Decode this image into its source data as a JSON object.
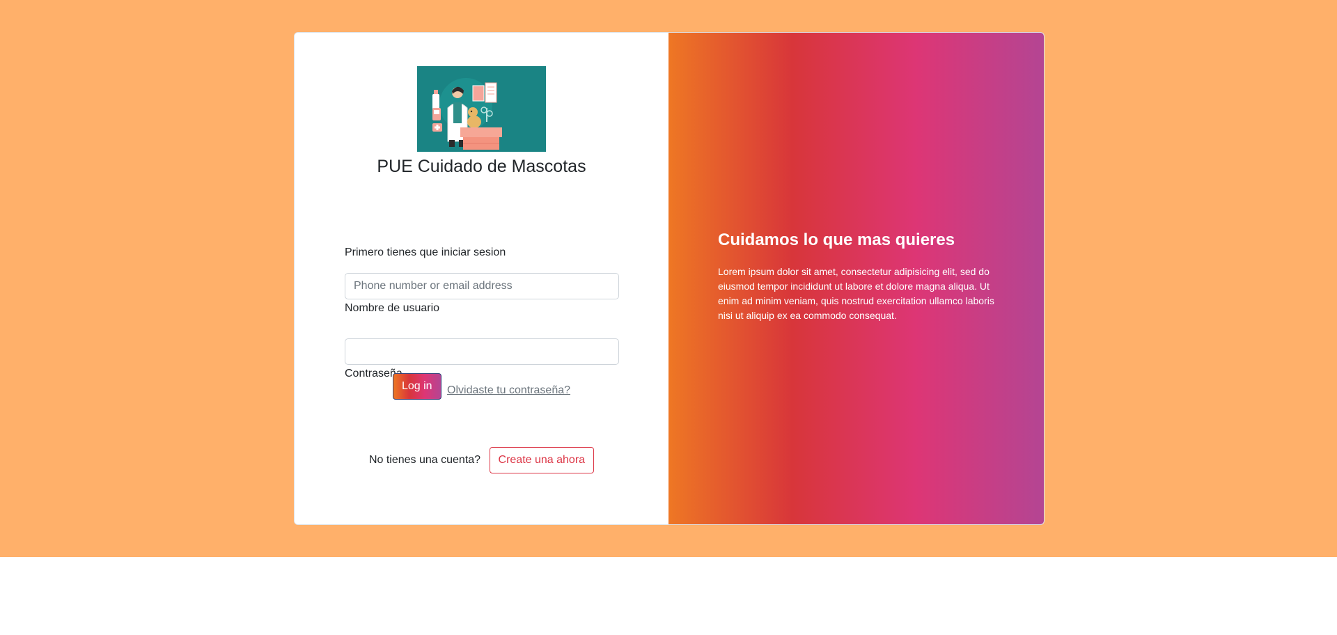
{
  "colors": {
    "page_background": "#ffb06a",
    "gradient": [
      "#ee7724",
      "#d8363a",
      "#dd3675",
      "#b44593"
    ],
    "create_button": "#dc3545",
    "logo_background": "#1a8484"
  },
  "brand": {
    "logo_icon": "veterinarian-illustration-icon",
    "title": "PUE Cuidado de Mascotas"
  },
  "login": {
    "prompt": "Primero tienes que iniciar sesion",
    "username": {
      "placeholder": "Phone number or email address",
      "value": "",
      "label": "Nombre de usuario"
    },
    "password": {
      "value": "",
      "label": "Contraseña"
    },
    "login_button": "Log in",
    "forgot_link": "Olvidaste tu contraseña?"
  },
  "signup": {
    "prompt": "No tienes una cuenta?",
    "button": "Create una ahora"
  },
  "promo": {
    "heading": "Cuidamos lo que mas quieres",
    "body": "Lorem ipsum dolor sit amet, consectetur adipisicing elit, sed do eiusmod tempor incididunt ut labore et dolore magna aliqua. Ut enim ad minim veniam, quis nostrud exercitation ullamco laboris nisi ut aliquip ex ea commodo consequat."
  }
}
